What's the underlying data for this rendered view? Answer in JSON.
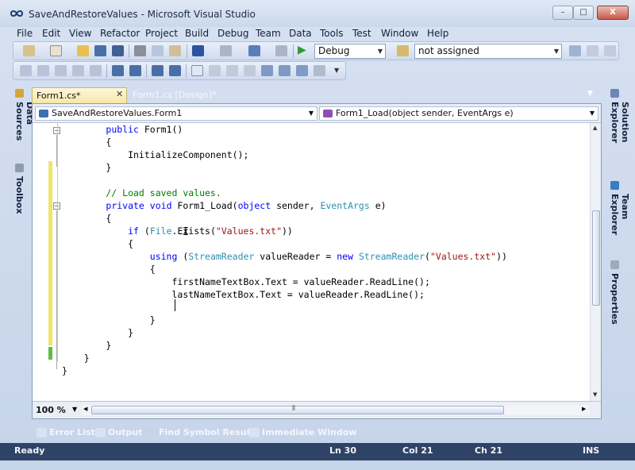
{
  "window": {
    "title": "SaveAndRestoreValues - Microsoft Visual Studio"
  },
  "title_buttons": {
    "minimize": "–",
    "maximize": "□",
    "close": "X"
  },
  "menu": [
    "File",
    "Edit",
    "View",
    "Refactor",
    "Project",
    "Build",
    "Debug",
    "Team",
    "Data",
    "Tools",
    "Test",
    "Window",
    "Help"
  ],
  "toolbar": {
    "config_value": "Debug",
    "platform_value": "not assigned"
  },
  "left_panels": [
    "Data Sources",
    "Toolbox"
  ],
  "right_panels": [
    "Solution Explorer",
    "Team Explorer",
    "Properties"
  ],
  "doc_tabs": [
    {
      "label": "Form1.cs*",
      "active": true
    },
    {
      "label": "Form1.cs [Design]*",
      "active": false
    }
  ],
  "nav": {
    "type_value": "SaveAndRestoreValues.Form1",
    "member_value": "Form1_Load(object sender, EventArgs e)"
  },
  "code": {
    "lines": [
      "        public Form1()",
      "        {",
      "            InitializeComponent();",
      "        }",
      "",
      "        // Load saved values.",
      "        private void Form1_Load(object sender, EventArgs e)",
      "        {",
      "            if (File.Exists(\"Values.txt\"))",
      "            {",
      "                using (StreamReader valueReader = new StreamReader(\"Values.txt\"))",
      "                {",
      "                    firstNameTextBox.Text = valueReader.ReadLine();",
      "                    lastNameTextBox.Text = valueReader.ReadLine();",
      "",
      "                }",
      "            }",
      "        }",
      "    }",
      "}"
    ]
  },
  "editor_bottom": {
    "zoom": "100 %"
  },
  "tool_tabs": [
    "Error List",
    "Output",
    "Find Symbol Results",
    "Immediate Window"
  ],
  "status": {
    "state": "Ready",
    "line": "Ln 30",
    "col": "Col 21",
    "ch": "Ch 21",
    "mode": "INS"
  },
  "colors": {
    "keyword": "#0000ff",
    "type": "#2b91af",
    "string": "#a31515",
    "comment": "#008000",
    "change_saved": "#5fbf3c",
    "change_unsaved": "#f0e46a"
  }
}
